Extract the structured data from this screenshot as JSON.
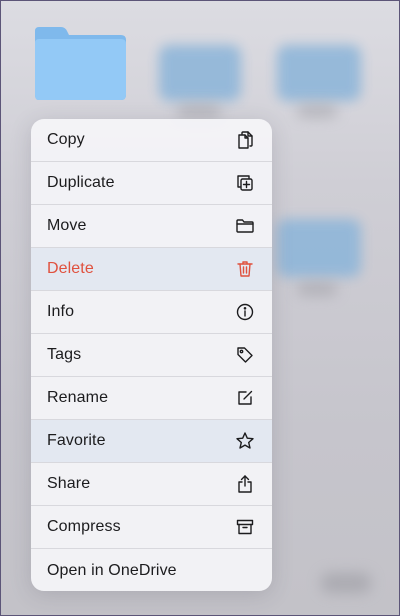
{
  "menu": {
    "items": [
      {
        "label": "Copy",
        "icon": "copy-icon"
      },
      {
        "label": "Duplicate",
        "icon": "duplicate-icon"
      },
      {
        "label": "Move",
        "icon": "folder-icon"
      },
      {
        "label": "Delete",
        "icon": "trash-icon",
        "destructive": true
      },
      {
        "label": "Info",
        "icon": "info-icon"
      },
      {
        "label": "Tags",
        "icon": "tag-icon"
      },
      {
        "label": "Rename",
        "icon": "rename-icon"
      },
      {
        "label": "Favorite",
        "icon": "star-icon"
      },
      {
        "label": "Share",
        "icon": "share-icon"
      },
      {
        "label": "Compress",
        "icon": "archive-icon"
      },
      {
        "label": "Open in OneDrive",
        "icon": null
      }
    ]
  },
  "colors": {
    "destructive": "#e0513e",
    "folder": "#8ec5f3",
    "menu_background": "#f4f4f7"
  }
}
